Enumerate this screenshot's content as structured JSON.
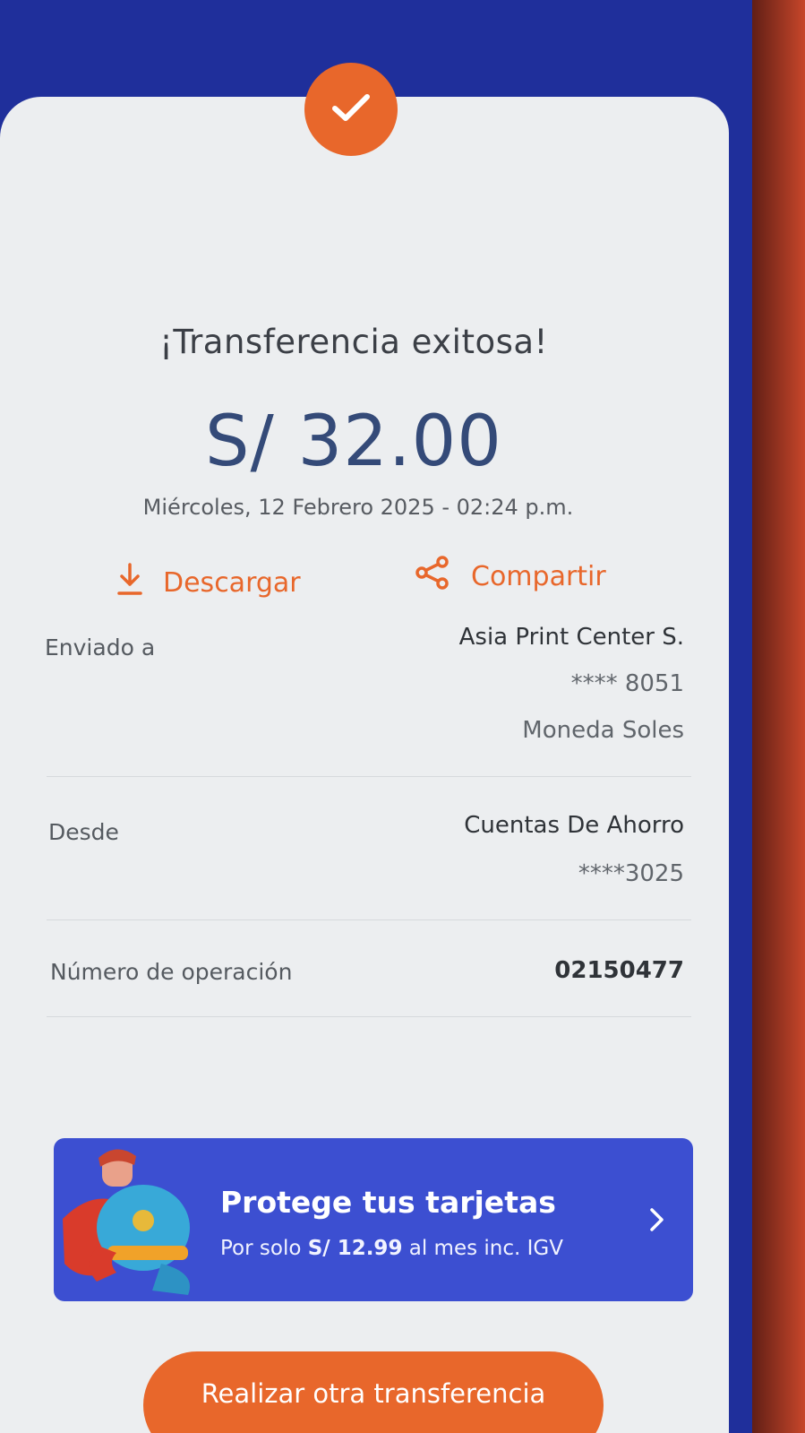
{
  "receipt": {
    "title": "¡Transferencia exitosa!",
    "amount": "S/ 32.00",
    "datetime": "Miércoles, 12 Febrero 2025 - 02:24 p.m.",
    "status_icon": "check-icon"
  },
  "actions": {
    "download_label": "Descargar",
    "download_icon": "download-icon",
    "share_label": "Compartir",
    "share_icon": "share-icon"
  },
  "details": {
    "sent_to": {
      "label": "Enviado a",
      "name": "Asia Print Center S.",
      "account": "**** 8051",
      "currency": "Moneda Soles"
    },
    "from": {
      "label": "Desde",
      "account_type": "Cuentas De Ahorro",
      "account": "****3025"
    },
    "operation": {
      "label": "Número de operación",
      "value": "02150477"
    }
  },
  "promo": {
    "title": "Protege tus tarjetas",
    "sub_prefix": "Por solo ",
    "price": "S/ 12.99",
    "sub_suffix": " al mes inc. IGV",
    "illustration": "superhero-mascot-illustration",
    "chevron_icon": "chevron-right-icon"
  },
  "cta": {
    "label": "Realizar otra transferencia"
  },
  "colors": {
    "accent": "#e8672b",
    "header_blue": "#1f2f9b",
    "promo_blue": "#3c4fd1",
    "amount_text": "#344a78"
  }
}
